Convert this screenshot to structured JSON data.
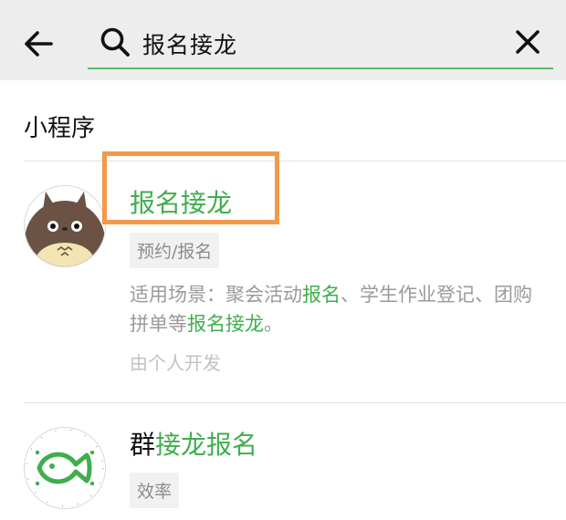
{
  "search": {
    "query": "报名接龙"
  },
  "section": {
    "title": "小程序"
  },
  "results": [
    {
      "title_plain": "",
      "title_highlight": "报名接龙",
      "tag": "预约/报名",
      "desc_parts": [
        "适用场景：聚会活动",
        "报名",
        "、学生作业登记、团购拼单等",
        "报名接龙",
        "。"
      ],
      "developer": "由个人开发"
    },
    {
      "title_plain": "群",
      "title_highlight": "接龙报名",
      "tag": "效率"
    }
  ],
  "colors": {
    "accent": "#3fae4c",
    "highlight_box": "#f2994a",
    "header_bg": "#ededed"
  }
}
